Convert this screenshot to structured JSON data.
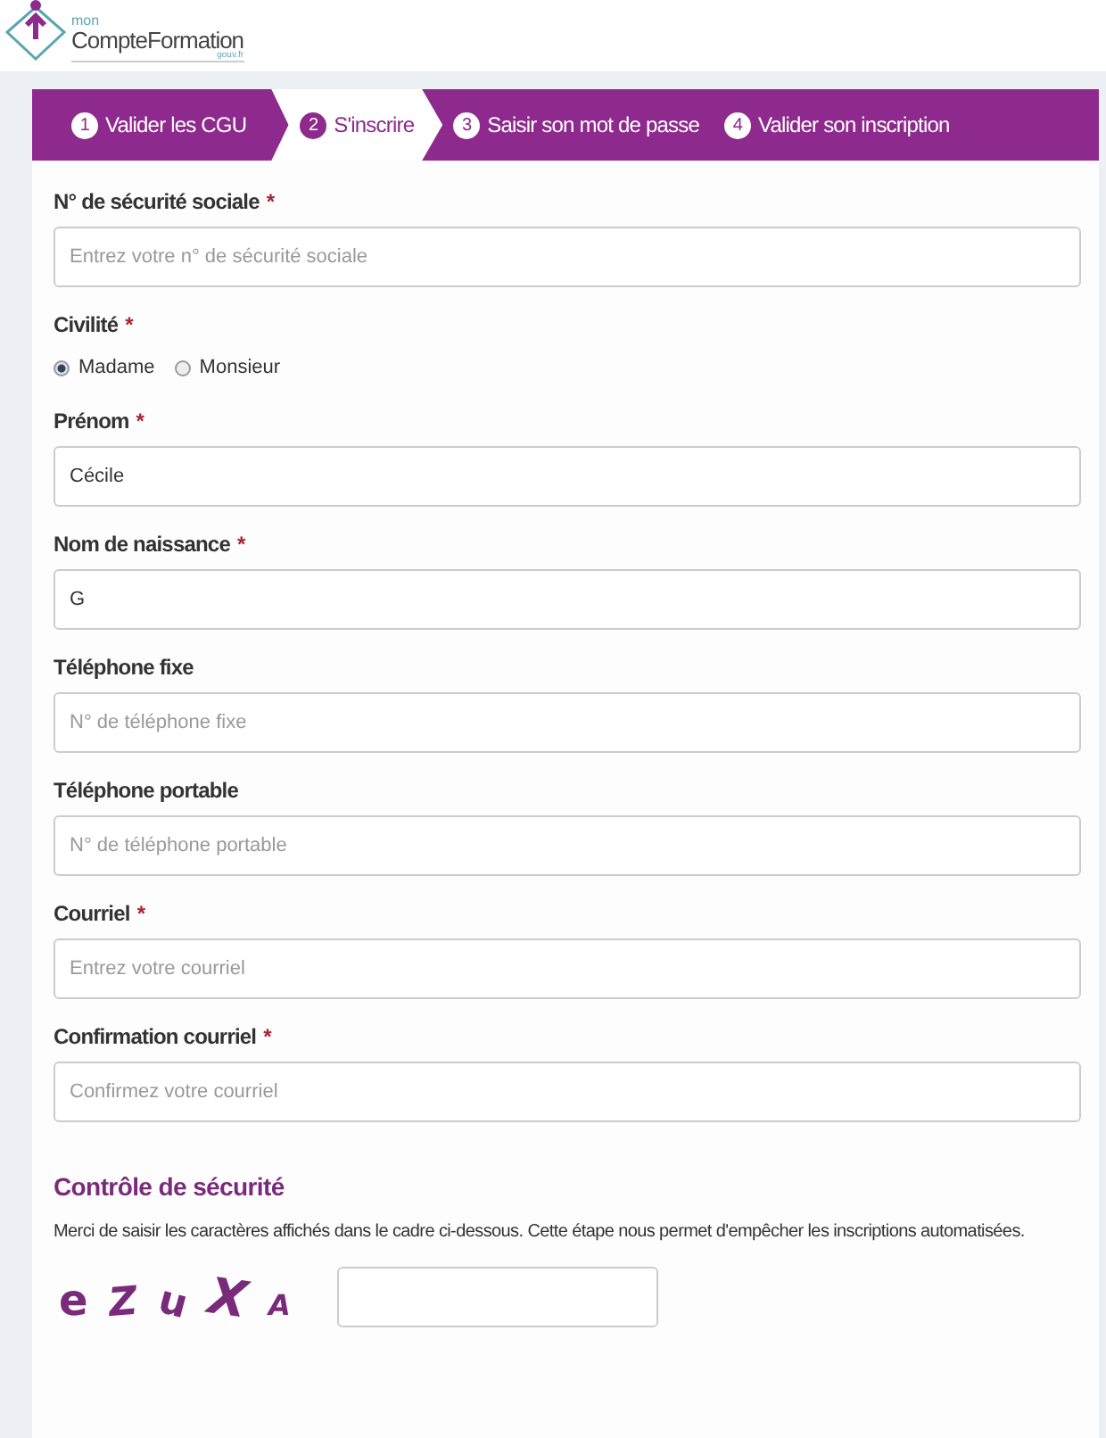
{
  "logo": {
    "prefix": "mon",
    "name": "CompteFormation",
    "suffix": "gouv.fr"
  },
  "steps": [
    {
      "number": "1",
      "label": "Valider les CGU",
      "selected": false
    },
    {
      "number": "2",
      "label": "S'inscrire",
      "selected": true
    },
    {
      "number": "3",
      "label": "Saisir son mot de passe",
      "selected": false
    },
    {
      "number": "4",
      "label": "Valider son inscription",
      "selected": false
    }
  ],
  "fields": [
    {
      "kind": "text",
      "label": "N° de sécurité sociale",
      "required_mark": "*",
      "placeholder": "Entrez votre n° de sécurité sociale"
    },
    {
      "kind": "radio",
      "label": "Civilité",
      "required_mark": "*",
      "options": [
        {
          "label": "Madame",
          "selected": true
        },
        {
          "label": "Monsieur",
          "selected": false
        }
      ]
    },
    {
      "kind": "text",
      "label": "Prénom",
      "required_mark": "*",
      "value": "Cécile"
    },
    {
      "kind": "text",
      "label": "Nom de naissance",
      "required_mark": "*",
      "value": "G"
    },
    {
      "kind": "text",
      "label": "Téléphone fixe",
      "placeholder": "N° de téléphone fixe"
    },
    {
      "kind": "text",
      "label": "Téléphone portable",
      "placeholder": "N° de téléphone portable"
    },
    {
      "kind": "text",
      "label": "Courriel",
      "required_mark": "*",
      "placeholder": "Entrez votre courriel"
    },
    {
      "kind": "text",
      "label": "Confirmation courriel",
      "required_mark": "*",
      "placeholder": "Confirmez votre courriel"
    }
  ],
  "security": {
    "title": "Contrôle de sécurité",
    "text": "Merci de saisir les caractères affichés dans le cadre ci-dessous. Cette étape nous permet d'empêcher les inscriptions automatisées.",
    "captcha": [
      "e",
      "Z",
      "u",
      "X",
      "A"
    ]
  }
}
